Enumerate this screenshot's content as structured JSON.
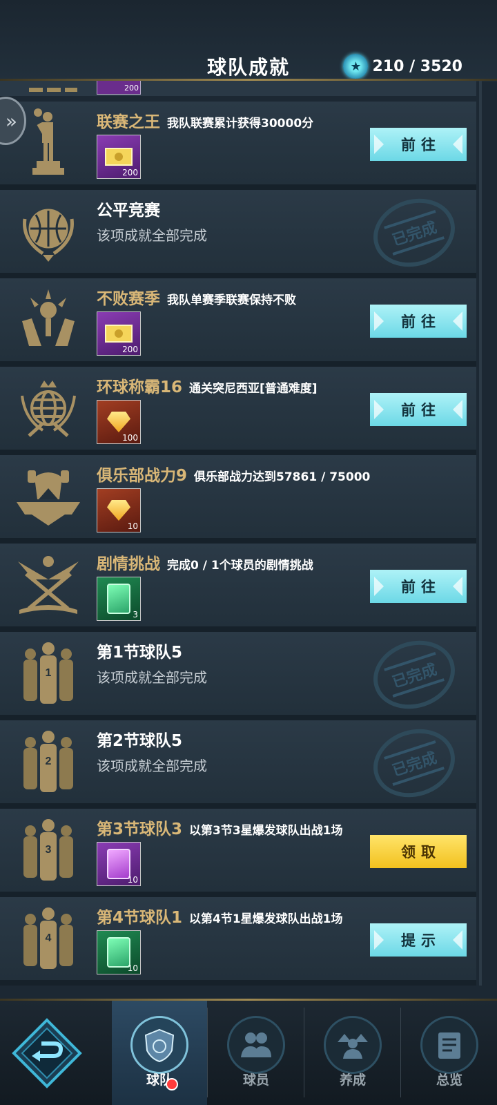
{
  "header": {
    "title": "球队成就",
    "points": "210 / 3520",
    "points_icon": "star-medal-icon"
  },
  "partial_row": {
    "reward_count": "200"
  },
  "achievements": [
    {
      "title": "联赛之王",
      "desc": "我队联赛累计获得30000分",
      "reward_type": "ticket",
      "reward_count": "200",
      "button": "前往",
      "badge": "trophy-statue-icon"
    },
    {
      "title": "公平竞赛",
      "sub": "该项成就全部完成",
      "stamp": "已完成",
      "badge": "basketball-laurel-icon"
    },
    {
      "title": "不败赛季",
      "desc": "我队单赛季联赛保持不败",
      "reward_type": "ticket",
      "reward_count": "200",
      "button": "前往",
      "badge": "hands-trophy-icon"
    },
    {
      "title": "环球称霸16",
      "desc": "通关突尼西亚[普通难度]",
      "reward_type": "gem",
      "reward_count": "100",
      "button": "前往",
      "badge": "globe-crown-icon"
    },
    {
      "title": "俱乐部战力9",
      "desc": "俱乐部战力达到57861 / 75000",
      "reward_type": "gem",
      "reward_count": "10",
      "badge": "club-crest-icon"
    },
    {
      "title": "剧情挑战",
      "desc": "完成0 / 1个球员的剧情挑战",
      "reward_type": "card-green",
      "reward_count": "3",
      "button": "前往",
      "badge": "crossed-flags-icon"
    },
    {
      "title": "第1节球队5",
      "sub": "该项成就全部完成",
      "stamp": "已完成",
      "badge": "team-silhouette-icon",
      "jersey": "1"
    },
    {
      "title": "第2节球队5",
      "sub": "该项成就全部完成",
      "stamp": "已完成",
      "badge": "team-silhouette-icon",
      "jersey": "2"
    },
    {
      "title": "第3节球队3",
      "desc": "以第3节3星爆发球队出战1场",
      "reward_type": "card-purple",
      "reward_count": "10",
      "button": "领取",
      "badge": "team-silhouette-icon",
      "jersey": "3"
    },
    {
      "title": "第4节球队1",
      "desc": "以第4节1星爆发球队出战1场",
      "reward_type": "card-green",
      "reward_count": "10",
      "button": "提示",
      "badge": "team-silhouette-icon",
      "jersey": "4"
    }
  ],
  "nav": {
    "items": [
      {
        "label": "球队",
        "icon": "team-shield-icon",
        "active": true,
        "badge_dot": true
      },
      {
        "label": "球员",
        "icon": "players-icon"
      },
      {
        "label": "养成",
        "icon": "upgrade-icon"
      },
      {
        "label": "总览",
        "icon": "overview-icon"
      }
    ]
  }
}
